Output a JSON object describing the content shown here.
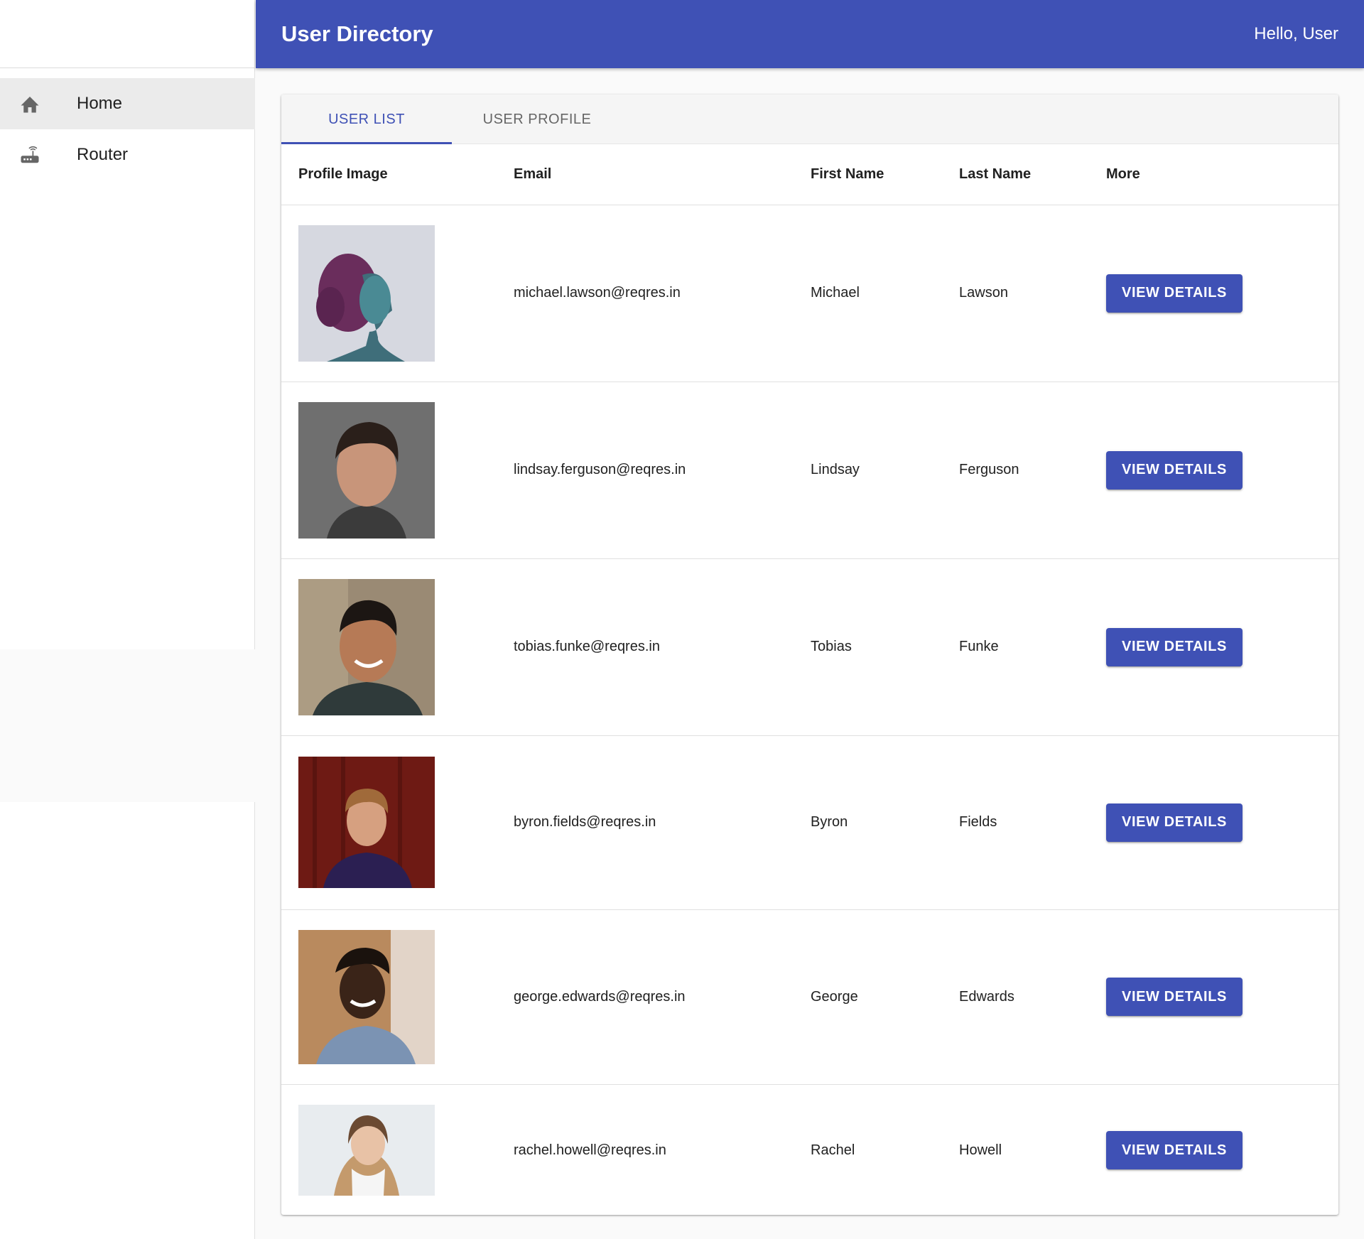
{
  "app": {
    "title": "User Directory",
    "greeting": "Hello, User",
    "primary_color": "#3f51b5"
  },
  "sidebar": {
    "items": [
      {
        "label": "Home",
        "icon": "home-icon",
        "selected": true
      },
      {
        "label": "Router",
        "icon": "router-icon",
        "selected": false
      }
    ]
  },
  "tabs": [
    {
      "label": "USER LIST",
      "active": true
    },
    {
      "label": "USER PROFILE",
      "active": false
    }
  ],
  "table": {
    "columns": [
      "Profile Image",
      "Email",
      "First Name",
      "Last Name",
      "More"
    ],
    "button_label": "VIEW DETAILS",
    "rows": [
      {
        "email": "michael.lawson@reqres.in",
        "first_name": "Michael",
        "last_name": "Lawson"
      },
      {
        "email": "lindsay.ferguson@reqres.in",
        "first_name": "Lindsay",
        "last_name": "Ferguson"
      },
      {
        "email": "tobias.funke@reqres.in",
        "first_name": "Tobias",
        "last_name": "Funke"
      },
      {
        "email": "byron.fields@reqres.in",
        "first_name": "Byron",
        "last_name": "Fields"
      },
      {
        "email": "george.edwards@reqres.in",
        "first_name": "George",
        "last_name": "Edwards"
      },
      {
        "email": "rachel.howell@reqres.in",
        "first_name": "Rachel",
        "last_name": "Howell"
      }
    ]
  }
}
